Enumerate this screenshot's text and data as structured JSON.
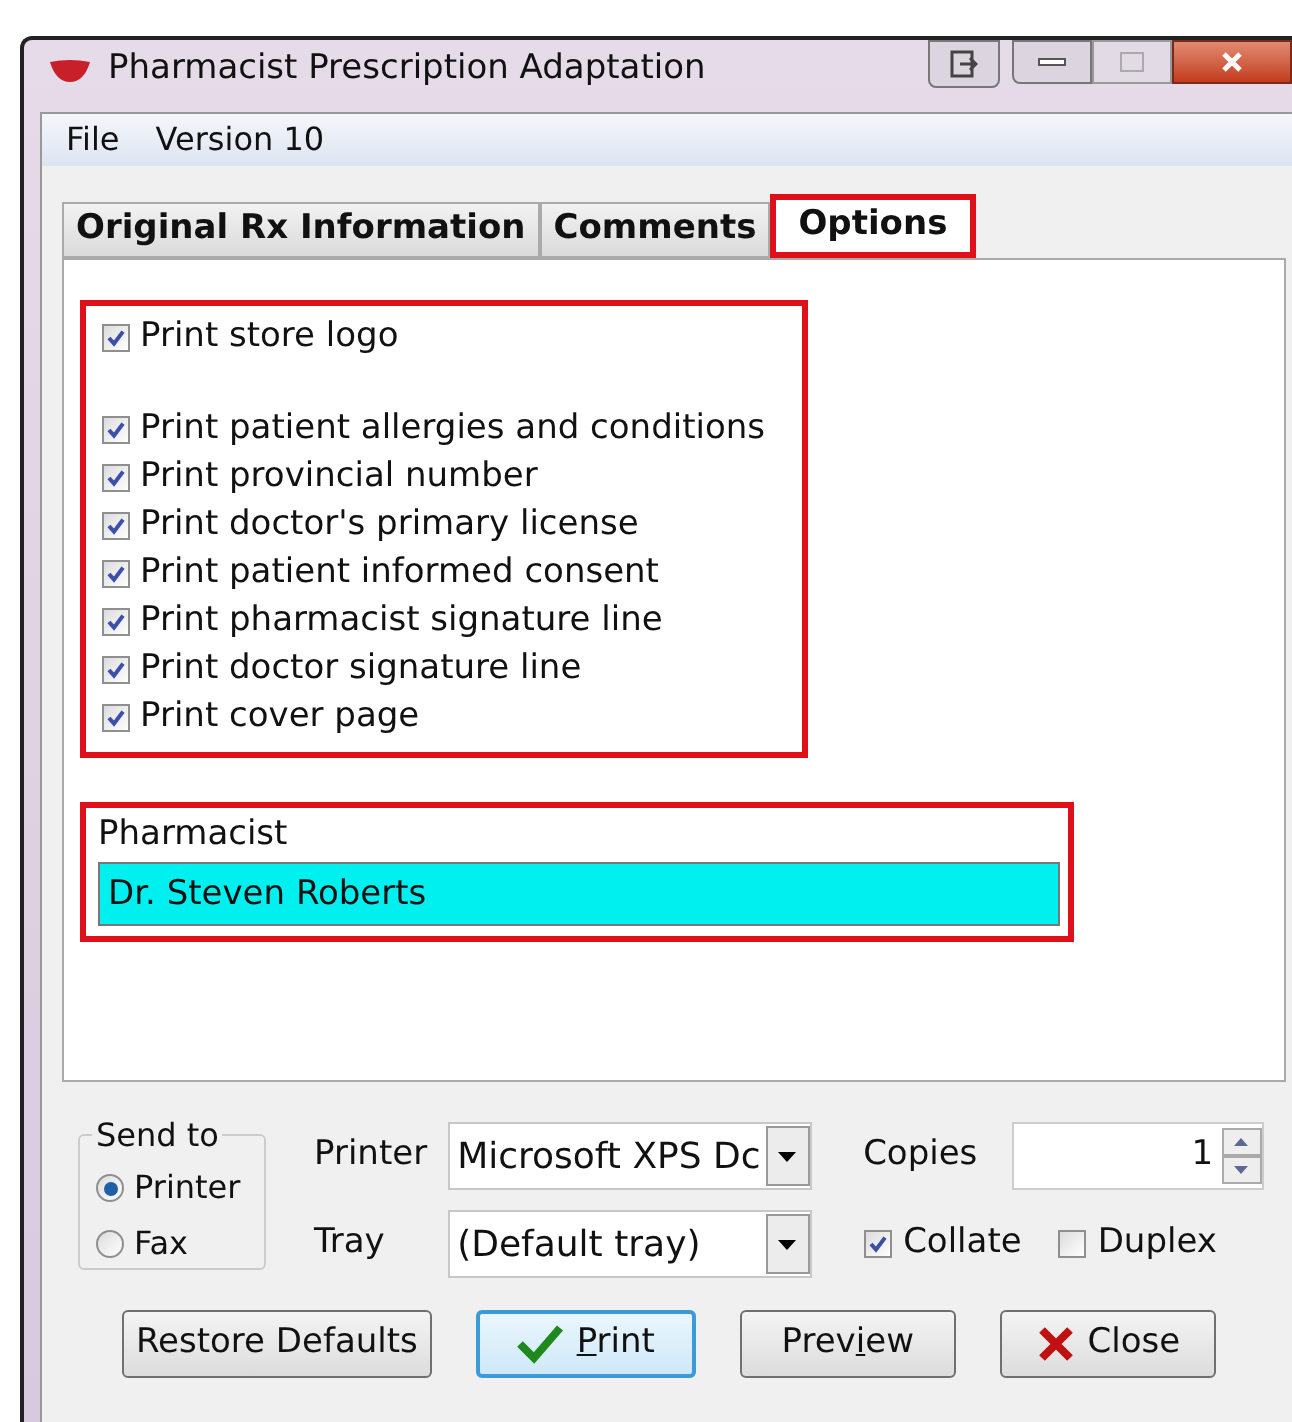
{
  "window": {
    "title": "Pharmacist Prescription Adaptation"
  },
  "menu": [
    "File",
    "Version 10"
  ],
  "tabs": [
    {
      "label": "Original Rx Information",
      "selected": false,
      "highlighted": false
    },
    {
      "label": "Comments",
      "selected": false,
      "highlighted": false
    },
    {
      "label": "Options",
      "selected": true,
      "highlighted": true
    }
  ],
  "options": {
    "highlighted": true,
    "groups": [
      [
        {
          "label": "Print store logo",
          "checked": true
        }
      ],
      [
        {
          "label": "Print patient allergies and conditions",
          "checked": true
        },
        {
          "label": "Print provincial number",
          "checked": true
        },
        {
          "label": "Print doctor's primary license",
          "checked": true
        },
        {
          "label": "Print patient informed consent",
          "checked": true
        },
        {
          "label": "Print pharmacist signature line",
          "checked": true
        },
        {
          "label": "Print doctor signature line",
          "checked": true
        },
        {
          "label": "Print cover page",
          "checked": true
        }
      ]
    ]
  },
  "pharmacist": {
    "label": "Pharmacist",
    "value": "Dr. Steven Roberts",
    "highlighted": true
  },
  "send_to": {
    "label": "Send to",
    "options": [
      {
        "label": "Printer",
        "selected": true
      },
      {
        "label": "Fax",
        "selected": false
      }
    ]
  },
  "printer": {
    "label": "Printer",
    "value": "Microsoft XPS Dc"
  },
  "tray": {
    "label": "Tray",
    "value": "(Default tray)"
  },
  "copies": {
    "label": "Copies",
    "value": "1"
  },
  "collate": {
    "label": "Collate",
    "checked": true
  },
  "duplex": {
    "label": "Duplex",
    "checked": false
  },
  "buttons": [
    {
      "label": "Restore Defaults",
      "kind": "plain",
      "default": false
    },
    {
      "label": "Print",
      "kind": "confirm",
      "default": true
    },
    {
      "label": "Preview",
      "kind": "plain",
      "default": false
    },
    {
      "label": "Close",
      "kind": "cancel",
      "default": false
    }
  ]
}
